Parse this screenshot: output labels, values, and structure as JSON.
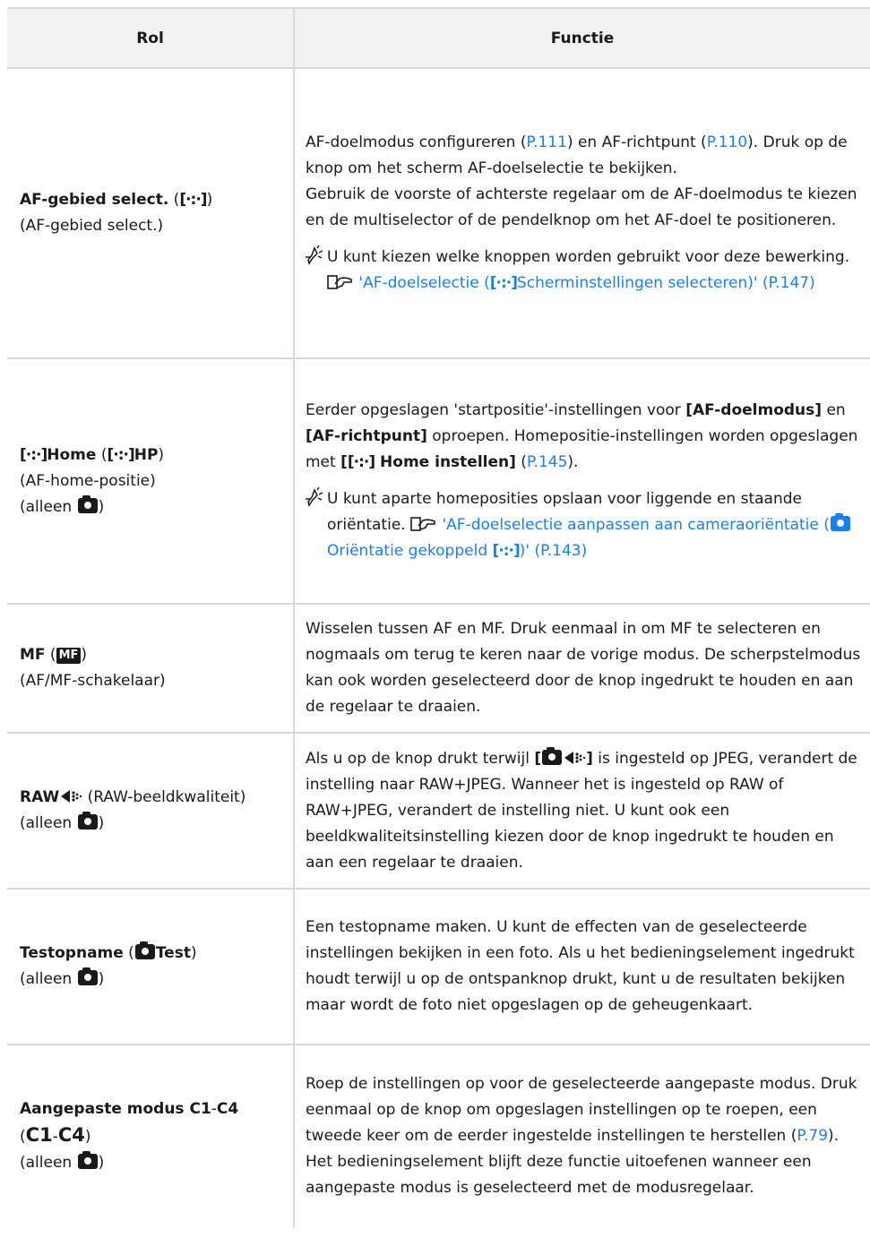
{
  "headers": {
    "rol": "Rol",
    "functie": "Functie"
  },
  "rows": [
    {
      "rol_name": "AF-gebied select.",
      "rol_paren_open": " (",
      "rol_icon": "[·:·]",
      "rol_paren_close": ")",
      "rol_sub": "(AF-gebied select.)",
      "f_p1a": "AF-doelmodus configureren (",
      "f_l1": "P.111",
      "f_p1b": ") en AF-richtpunt (",
      "f_l2": "P.110",
      "f_p1c": "). Druk op de knop om het scherm AF-doelselectie te bekijken.",
      "f_p2": "Gebruik de voorste of achterste regelaar om de AF-doelmodus te kiezen en de multiselector of de pendelknop om het AF-doel te positioneren.",
      "hint_text": "U kunt kiezen welke knoppen worden gebruikt voor deze bewerking.",
      "hint_link_a": "'AF-doelselectie (",
      "hint_link_icon": "[·:·]",
      "hint_link_b": "Scherminstellingen selecteren)' (P.147)"
    },
    {
      "rol_icon": "[·:·]",
      "rol_name": "Home",
      "rol_paren_open": " (",
      "rol_icon2": "[·:·]",
      "rol_short": "HP",
      "rol_paren_close": ")",
      "rol_sub": "(AF-home-positie)",
      "rol_only": "(alleen ",
      "rol_only_close": ")",
      "f_a": "Eerder opgeslagen 'startpositie'-instellingen voor ",
      "f_b1": "[AF-doelmodus]",
      "f_c": " en ",
      "f_b2": "[AF-richtpunt]",
      "f_d": " oproepen. Homepositie-instellingen worden opgeslagen met ",
      "f_b3a": "[",
      "f_b3icon": "[·:·]",
      "f_b3b": " Home instellen]",
      "f_e": " (",
      "f_l": "P.145",
      "f_f": ").",
      "hint_text": "U kunt aparte homeposities opslaan voor liggende en staande oriëntatie.",
      "hint_link_a": "'AF-doelselectie aanpassen aan cameraoriëntatie (",
      "hint_link_b": "Oriëntatie gekoppeld ",
      "hint_link_icon": "[·:·]",
      "hint_link_c": ")' (P.143)"
    },
    {
      "rol_name": "MF",
      "rol_paren_open": " (",
      "rol_badge": "MF",
      "rol_paren_close": ")",
      "rol_sub": "(AF/MF-schakelaar)",
      "f_text": "Wisselen tussen AF en MF. Druk eenmaal in om MF te selecteren en nogmaals om terug te keren naar de vorige modus. De scherpstelmodus kan ook worden geselecteerd door de knop ingedrukt te houden en aan de regelaar te draaien."
    },
    {
      "rol_name": "RAW",
      "rol_after": " (RAW-beeldkwaliteit)",
      "rol_only": "(alleen ",
      "rol_only_close": ")",
      "f_a": "Als u op de knop drukt terwijl ",
      "f_b1": "[",
      "f_b2": "]",
      "f_c": " is ingesteld op JPEG, verandert de instelling naar RAW+JPEG. Wanneer het is ingesteld op RAW of RAW+JPEG, verandert de instelling niet. U kunt ook een beeldkwaliteitsinstelling kiezen door de knop ingedrukt te houden en aan een regelaar te draaien."
    },
    {
      "rol_name": "Testopname",
      "rol_paren_open": " (",
      "rol_short": "Test",
      "rol_paren_close": ")",
      "rol_only": "(alleen ",
      "rol_only_close": ")",
      "f_text": "Een testopname maken. U kunt de effecten van de geselecteerde instellingen bekijken in een foto. Als u het bedieningselement ingedrukt houdt terwijl u op de ontspanknop drukt, kunt u de resultaten bekijken maar wordt de foto niet opgeslagen op de geheugenkaart."
    },
    {
      "rol_name": "Aangepaste modus C1",
      "rol_dash": "-",
      "rol_name2": "C4",
      "rol_paren_open": "(",
      "rol_c1": "C1",
      "rol_dash2": "-",
      "rol_c4": "C4",
      "rol_paren_close": ")",
      "rol_only": "(alleen ",
      "rol_only_close": ")",
      "f_a": "Roep de instellingen op voor de geselecteerde aangepaste modus. Druk eenmaal op de knop om opgeslagen instellingen op te roepen, een tweede keer om de eerder ingestelde instellingen te herstellen (",
      "f_l": "P.79",
      "f_b": "). Het bedieningselement blijft deze functie uitoefenen wanneer een aangepaste modus is geselecteerd met de modusregelaar."
    }
  ]
}
